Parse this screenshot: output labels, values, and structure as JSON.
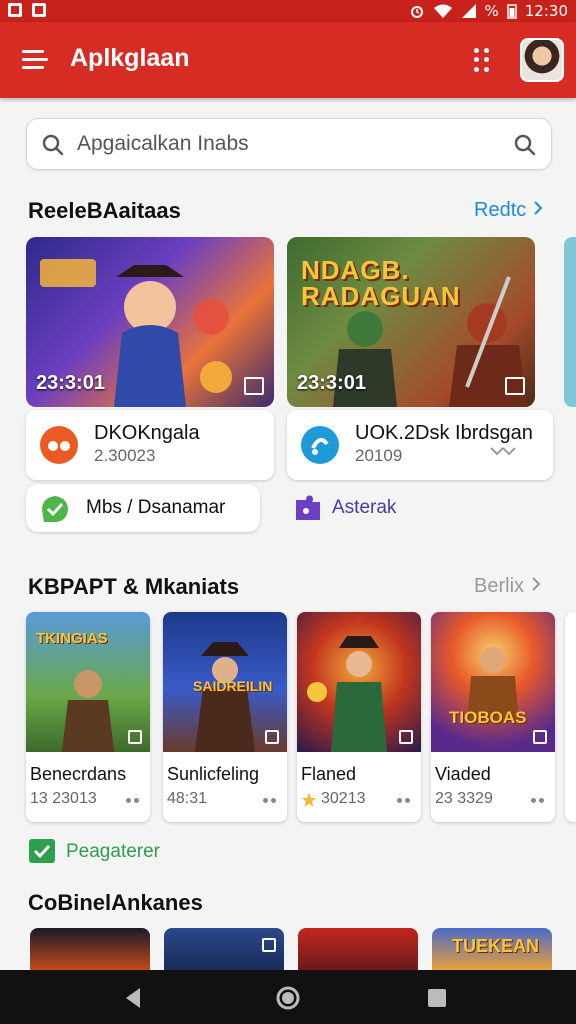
{
  "status_bar": {
    "time": "12:30",
    "battery": "%"
  },
  "appbar": {
    "title": "Aplkglaan"
  },
  "search": {
    "placeholder": "Apgaicalkan Inabs"
  },
  "section1": {
    "title": "ReeleBAaitaas",
    "more": "Redtc",
    "featured": [
      {
        "badge": "23:3:01",
        "art": ""
      },
      {
        "badge": "23:3:01",
        "art": "NDAGB. RADAGUAN"
      }
    ],
    "apps": [
      {
        "name": "DKOKngala",
        "value": "2.30023"
      },
      {
        "name": "UOK.2Dsk Ibrdsgan",
        "value": "20109"
      }
    ],
    "chips": [
      {
        "label": "Mbs / Dsanamar"
      },
      {
        "label": "Asterak"
      }
    ]
  },
  "section2": {
    "title": "KBPAPT & Mkaniats",
    "more": "Berlix",
    "cards": [
      {
        "title": "Benecrdans",
        "value": "13 23013",
        "art": "TKINGIAS"
      },
      {
        "title": "Sunlicfeling",
        "value": "48:31",
        "art": "SAIDREILIN"
      },
      {
        "title": "Flaned",
        "value": "30213",
        "art": ""
      },
      {
        "title": "Viaded",
        "value": "23 3329",
        "art": "TIOBOAS"
      }
    ],
    "check_label": "Peagaterer"
  },
  "section3": {
    "title": "CoBinelAnkanes",
    "card_art": "TUEKEAN"
  },
  "colors": {
    "primary": "#d62c24",
    "link_blue": "#1f88d6",
    "check_green": "#2e9e4f"
  }
}
